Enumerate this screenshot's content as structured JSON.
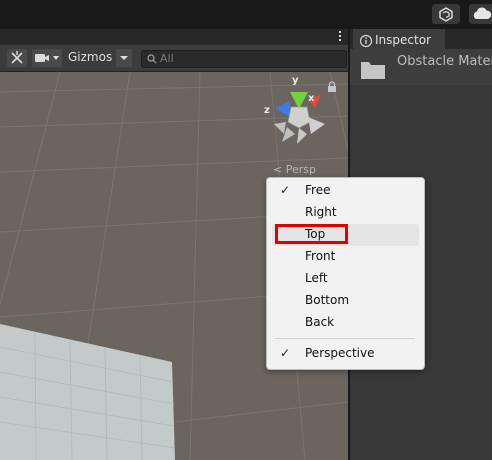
{
  "scene_toolbar": {
    "gizmos_label": "Gizmos",
    "search_placeholder": "All"
  },
  "gizmo": {
    "axis_y": "y",
    "axis_x": "x",
    "axis_z": "z",
    "projection_label": "Persp"
  },
  "inspector": {
    "tab_label": "Inspector",
    "object_name": "Obstacle Mater"
  },
  "view_menu": {
    "items": [
      {
        "label": "Free",
        "checked": "✓"
      },
      {
        "label": "Right",
        "checked": ""
      },
      {
        "label": "Top",
        "checked": ""
      },
      {
        "label": "Front",
        "checked": ""
      },
      {
        "label": "Left",
        "checked": ""
      },
      {
        "label": "Bottom",
        "checked": ""
      },
      {
        "label": "Back",
        "checked": ""
      },
      {
        "label": "Perspective",
        "checked": "✓"
      }
    ]
  }
}
